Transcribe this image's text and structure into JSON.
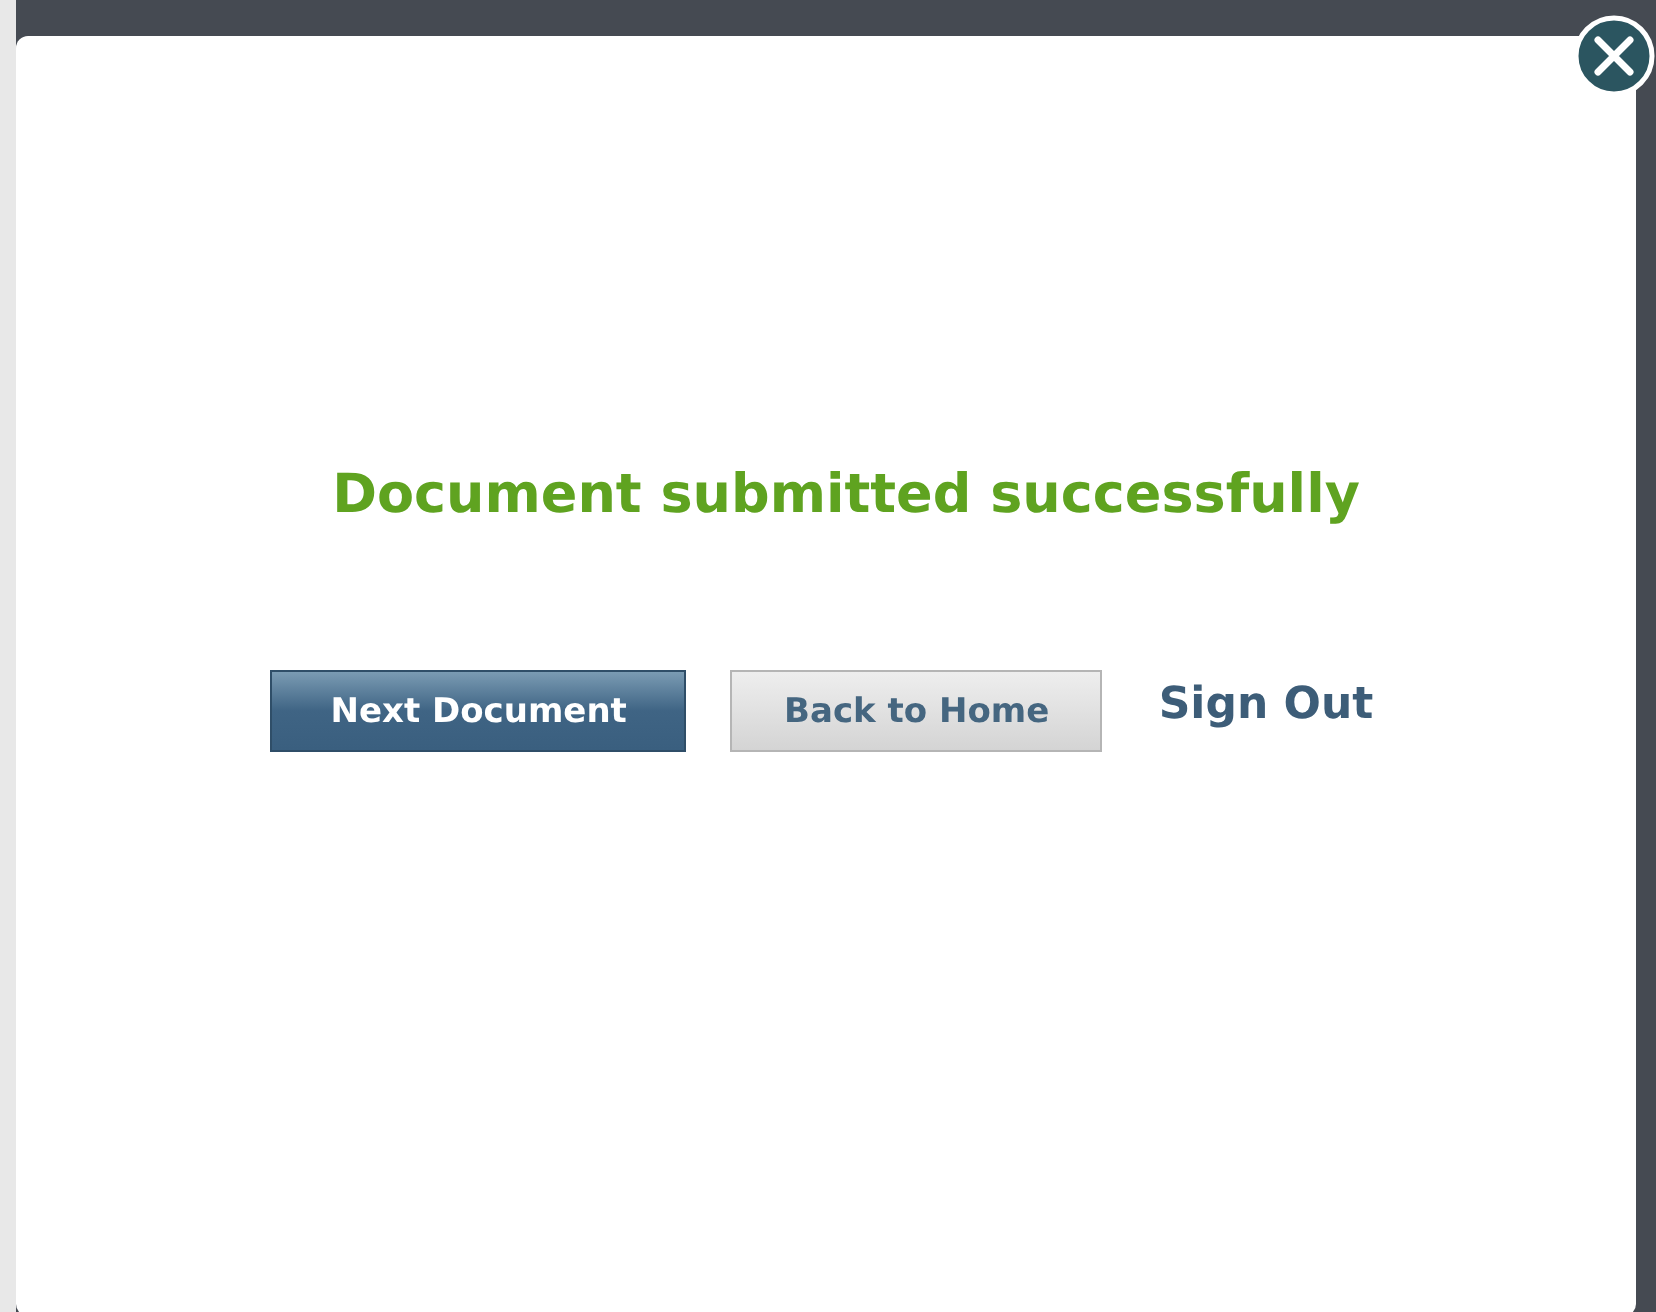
{
  "dialog": {
    "message": "Document submitted successfully",
    "actions": [
      {
        "label": "Next Document",
        "kind": "primary"
      },
      {
        "label": "Back to Home",
        "kind": "secondary"
      },
      {
        "label": "Sign Out",
        "kind": "link"
      }
    ]
  }
}
